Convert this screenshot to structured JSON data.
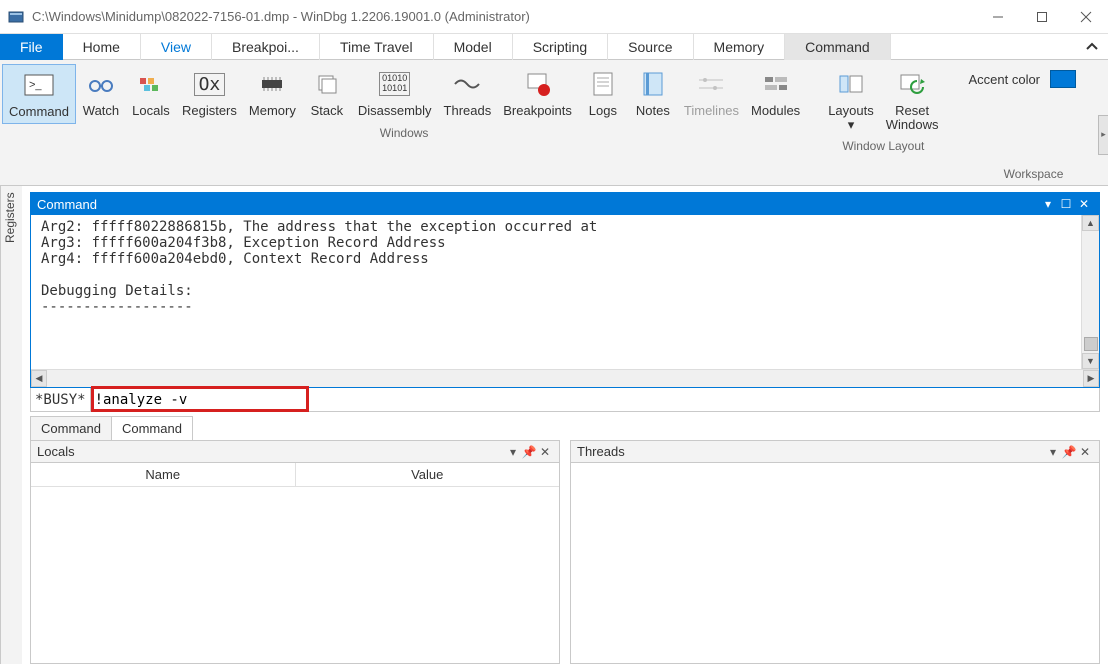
{
  "window": {
    "title": "C:\\Windows\\Minidump\\082022-7156-01.dmp - WinDbg 1.2206.19001.0 (Administrator)"
  },
  "tabs": {
    "file": "File",
    "home": "Home",
    "view": "View",
    "breakpoints": "Breakpoi...",
    "time_travel": "Time Travel",
    "model": "Model",
    "scripting": "Scripting",
    "source": "Source",
    "memory": "Memory",
    "command": "Command"
  },
  "ribbon": {
    "command": "Command",
    "watch": "Watch",
    "locals": "Locals",
    "registers": "Registers",
    "memory": "Memory",
    "stack": "Stack",
    "disassembly": "Disassembly",
    "threads": "Threads",
    "breakpoints": "Breakpoints",
    "logs": "Logs",
    "notes": "Notes",
    "timelines": "Timelines",
    "modules": "Modules",
    "layouts": "Layouts\n▾",
    "reset_windows": "Reset\nWindows",
    "group_windows": "Windows",
    "group_layout": "Window Layout",
    "group_workspace": "Workspace",
    "accent_label": "Accent color",
    "ox_text": "Ox",
    "bin_text1": "01010",
    "bin_text2": "10101"
  },
  "side_tab": "Registers",
  "command_panel": {
    "title": "Command",
    "output": "Arg2: fffff8022886815b, The address that the exception occurred at\nArg3: fffff600a204f3b8, Exception Record Address\nArg4: fffff600a204ebd0, Context Record Address\n\nDebugging Details:\n------------------",
    "status": "*BUSY*",
    "input_value": "!analyze -v"
  },
  "dock_tabs": {
    "t1": "Command",
    "t2": "Command"
  },
  "panels": {
    "locals": {
      "title": "Locals",
      "col_name": "Name",
      "col_value": "Value"
    },
    "threads": {
      "title": "Threads"
    }
  }
}
